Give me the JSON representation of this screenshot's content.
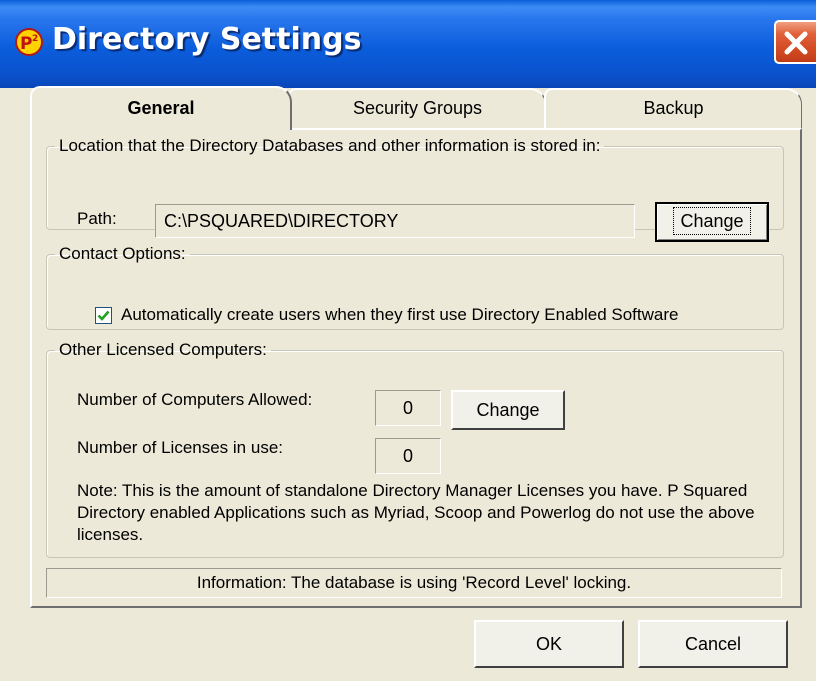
{
  "window": {
    "title": "Directory Settings",
    "icon": "p-squared-app-icon",
    "close_icon": "close-icon"
  },
  "tabs": [
    {
      "label": "General",
      "active": true
    },
    {
      "label": "Security Groups",
      "active": false
    },
    {
      "label": "Backup",
      "active": false
    }
  ],
  "location": {
    "legend": "Location that the Directory Databases and other information is stored in:",
    "path_label": "Path:",
    "path_value": "C:\\PSQUARED\\DIRECTORY",
    "change_label": "Change"
  },
  "contact": {
    "legend": "Contact Options:",
    "auto_create_label": "Automatically create users when they first use Directory Enabled Software",
    "auto_create_checked": true
  },
  "other": {
    "legend": "Other Licensed Computers:",
    "allowed_label": "Number of Computers Allowed:",
    "allowed_value": "0",
    "change_label": "Change",
    "in_use_label": "Number of Licenses in use:",
    "in_use_value": "0",
    "note": "Note: This is the amount of standalone Directory Manager Licenses you have. P Squared Directory enabled Applications such as Myriad, Scoop and Powerlog do not use the above licenses."
  },
  "status": {
    "text": "Information: The database is using 'Record Level' locking."
  },
  "buttons": {
    "ok": "OK",
    "cancel": "Cancel"
  },
  "colors": {
    "titlebar": "#0a5fd8",
    "close": "#d24a22",
    "face": "#ece9d8"
  }
}
